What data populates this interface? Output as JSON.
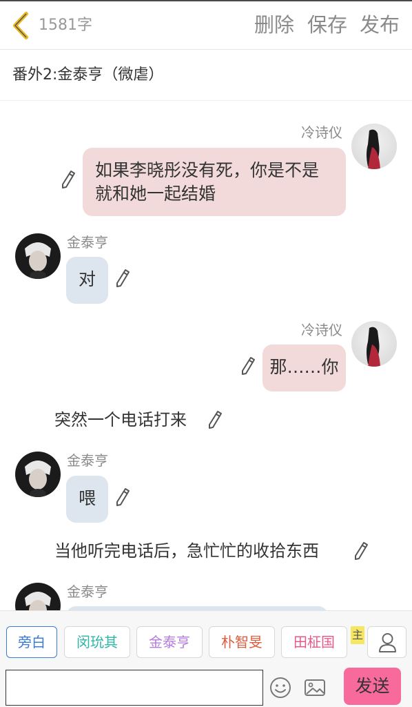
{
  "header": {
    "word_count": "1581字",
    "delete_label": "删除",
    "save_label": "保存",
    "publish_label": "发布"
  },
  "chapter_title": "番外2:金泰亨（微虐）",
  "messages": [
    {
      "speaker": "冷诗仪",
      "text_line1": "如果李晓彤没有死，你是不是",
      "text_line2": "就和她一起结婚"
    },
    {
      "speaker": "金泰亨",
      "text": "对"
    },
    {
      "speaker": "冷诗仪",
      "text": "那……你"
    },
    {
      "narration": "突然一个电话打来"
    },
    {
      "speaker": "金泰亨",
      "text": "喂"
    },
    {
      "narration": "当他听完电话后，急忙忙的收拾东西"
    },
    {
      "speaker": "金泰亨",
      "text": ""
    }
  ],
  "roles": [
    {
      "label": "旁白",
      "color": "#3b7bd4"
    },
    {
      "label": "闵玧其",
      "color": "#2bb5a5"
    },
    {
      "label": "金泰亨",
      "color": "#b57be0"
    },
    {
      "label": "朴智旻",
      "color": "#e05a3e"
    },
    {
      "label": "田柾国",
      "color": "#e8578a"
    }
  ],
  "main_badge": "主",
  "input": {
    "value": "",
    "placeholder": ""
  },
  "send_label": "发送",
  "colors": {
    "accent": "#f96a9c",
    "pink_bubble": "#f3dada",
    "blue_bubble": "#dde5ee",
    "back_arrow": "#e8b923"
  },
  "icons": [
    "back-icon",
    "pencil-icon",
    "emoji-icon",
    "image-icon",
    "person-icon"
  ]
}
